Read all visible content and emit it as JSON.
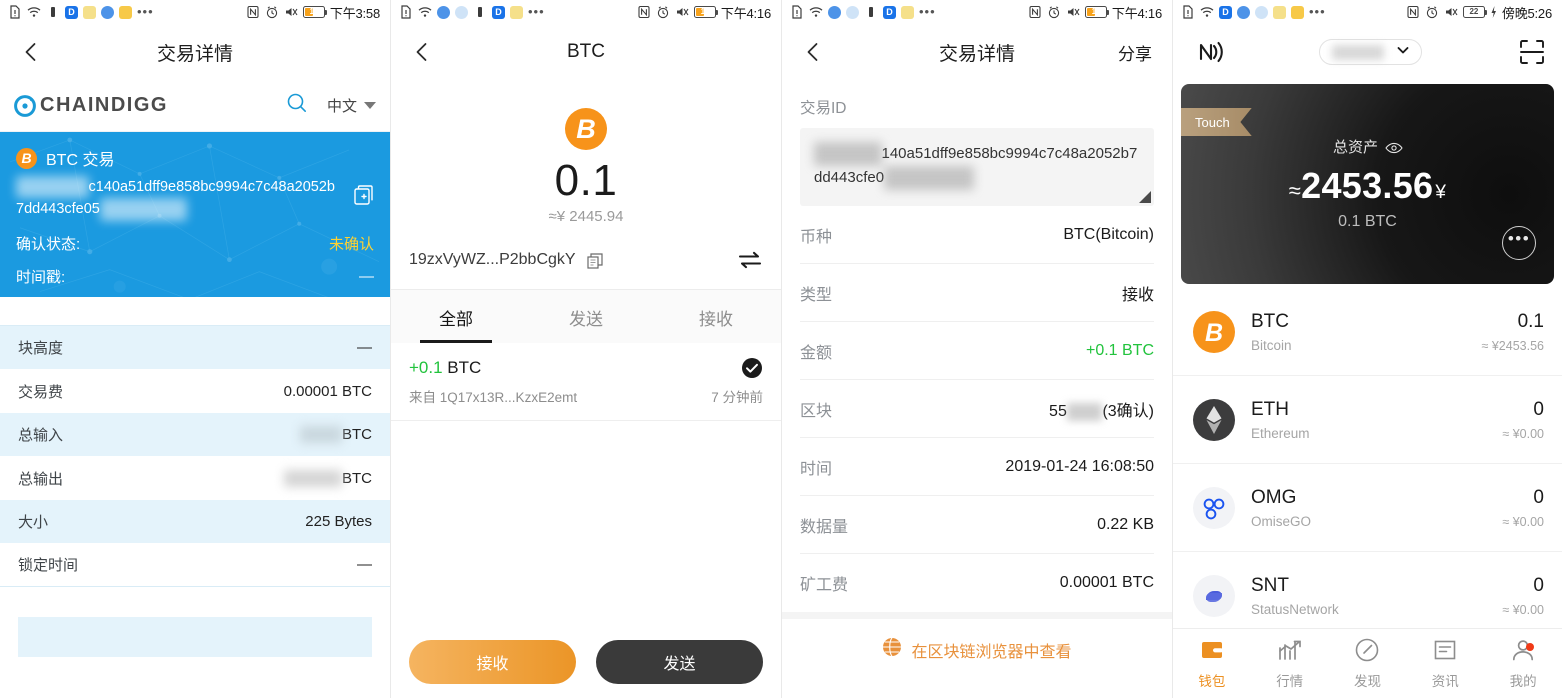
{
  "panel1": {
    "statusbar": {
      "time": "下午3:58",
      "battery": "12"
    },
    "nav": {
      "title": "交易详情"
    },
    "brand": {
      "logo_text": "CHAINDIGG",
      "lang": "中文"
    },
    "card": {
      "coin_badge": "B",
      "title": "BTC 交易",
      "hash_visible_1": "c140a51dff9e858bc9994c7c48a20",
      "hash_visible_2": "52b7dd443cfe05",
      "status_label": "确认状态:",
      "status_value": "未确认",
      "timestamp_label": "时间戳:",
      "timestamp_value": "—"
    },
    "rows": [
      {
        "key": "块高度",
        "value": "—",
        "alt": true
      },
      {
        "key": "交易费",
        "value": "0.00001 BTC",
        "alt": false
      },
      {
        "key": "总输入",
        "value": "BTC",
        "alt": true,
        "blurred": true
      },
      {
        "key": "总输出",
        "value": "BTC",
        "alt": false,
        "blurred": true
      },
      {
        "key": "大小",
        "value": "225 Bytes",
        "alt": true
      },
      {
        "key": "锁定时间",
        "value": "—",
        "alt": false
      }
    ]
  },
  "panel2": {
    "statusbar": {
      "time": "下午4:16",
      "battery": "11"
    },
    "nav": {
      "title": "BTC"
    },
    "hero": {
      "coin_badge": "B",
      "amount": "0.1",
      "fiat": "≈¥  2445.94",
      "address": "19zxVyWZ...P2bbCgkY"
    },
    "tabs": [
      {
        "label": "全部",
        "active": true
      },
      {
        "label": "发送",
        "active": false
      },
      {
        "label": "接收",
        "active": false
      }
    ],
    "transactions": [
      {
        "sign": "+0.1",
        "unit": "BTC",
        "from_label": "来自",
        "from_address": "1Q17x13R...KzxE2emt",
        "time": "7 分钟前"
      }
    ],
    "buttons": {
      "receive": "接收",
      "send": "发送"
    }
  },
  "panel3": {
    "statusbar": {
      "time": "下午4:16",
      "battery": "11"
    },
    "nav": {
      "title": "交易详情",
      "action": "分享"
    },
    "txid_label": "交易ID",
    "txid_visible_1": "140a51dff9e858bc9994c7c48a20",
    "txid_visible_2": "52b7dd443cfe0",
    "rows": [
      {
        "key": "币种",
        "value": "BTC(Bitcoin)",
        "green": false
      },
      {
        "key": "类型",
        "value": "接收",
        "green": false
      },
      {
        "key": "金额",
        "value": "+0.1 BTC",
        "green": true
      },
      {
        "key": "区块",
        "value_prefix": "55",
        "value_suffix": "(3确认)",
        "blurred": true,
        "green": false
      },
      {
        "key": "时间",
        "value": "2019-01-24 16:08:50",
        "green": false
      },
      {
        "key": "数据量",
        "value": "0.22 KB",
        "green": false
      },
      {
        "key": "矿工费",
        "value": "0.00001 BTC",
        "green": false
      }
    ],
    "explorer_link": "在区块链浏览器中查看"
  },
  "panel4": {
    "statusbar": {
      "time": "傍晚5:26",
      "battery": "22"
    },
    "card": {
      "ribbon": "Touch",
      "total_label": "总资产",
      "total_amount": "2453.56",
      "approx": "≈",
      "currency": "¥",
      "sub_amount": "0.1 BTC"
    },
    "coins": [
      {
        "symbol": "BTC",
        "name": "Bitcoin",
        "balance": "0.1",
        "fiat": "≈ ¥2453.56",
        "icon": "btc-icon"
      },
      {
        "symbol": "ETH",
        "name": "Ethereum",
        "balance": "0",
        "fiat": "≈ ¥0.00",
        "icon": "eth-icon"
      },
      {
        "symbol": "OMG",
        "name": "OmiseGO",
        "balance": "0",
        "fiat": "≈ ¥0.00",
        "icon": "omg-icon"
      },
      {
        "symbol": "SNT",
        "name": "StatusNetwork",
        "balance": "0",
        "fiat": "≈ ¥0.00",
        "icon": "snt-icon"
      }
    ],
    "bottom_nav": [
      {
        "label": "钱包",
        "icon": "wallet-icon",
        "active": true,
        "badge": false
      },
      {
        "label": "行情",
        "icon": "chart-icon",
        "active": false,
        "badge": false
      },
      {
        "label": "发现",
        "icon": "compass-icon",
        "active": false,
        "badge": false
      },
      {
        "label": "资讯",
        "icon": "news-icon",
        "active": false,
        "badge": false
      },
      {
        "label": "我的",
        "icon": "person-icon",
        "active": false,
        "badge": true
      }
    ]
  },
  "colors": {
    "brand_blue": "#1b9ae0",
    "btc_orange": "#f7931a",
    "accent_orange": "#ec9022",
    "positive_green": "#22c33d",
    "warn_yellow": "#ffd232"
  }
}
